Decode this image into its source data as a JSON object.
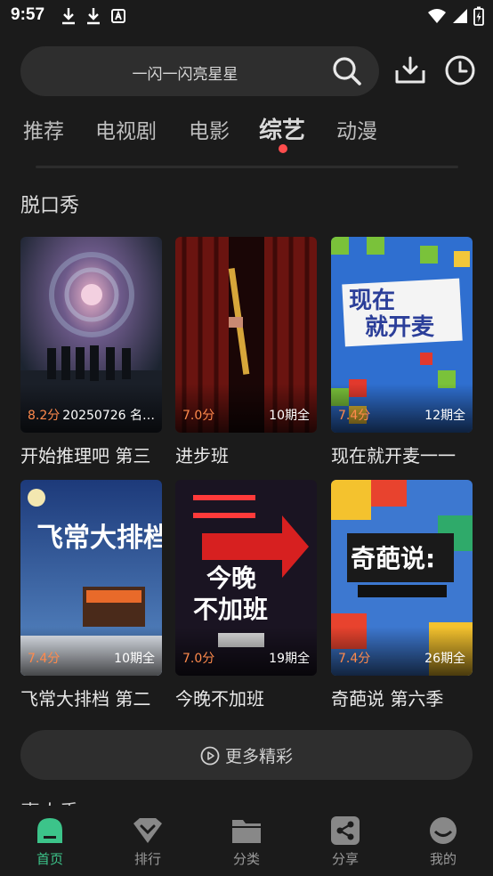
{
  "status_bar": {
    "time": "9:57"
  },
  "search": {
    "placeholder_text": "一闪一闪亮星星"
  },
  "tabs": [
    {
      "label": "推荐"
    },
    {
      "label": "电视剧"
    },
    {
      "label": "电影"
    },
    {
      "label": "综艺",
      "active": true
    },
    {
      "label": "动漫"
    }
  ],
  "section": {
    "title": "脱口秀"
  },
  "cards": [
    {
      "title": "开始推理吧 第三",
      "score": "8.2分",
      "episodes": "20250726 名…"
    },
    {
      "title": "进步班",
      "score": "7.0分",
      "episodes": "10期全"
    },
    {
      "title": "现在就开麦一一",
      "score": "7.4分",
      "episodes": "12期全"
    },
    {
      "title": "飞常大排档 第二",
      "score": "7.4分",
      "episodes": "10期全"
    },
    {
      "title": "今晚不加班",
      "score": "7.0分",
      "episodes": "19期全"
    },
    {
      "title": "奇葩说 第六季",
      "score": "7.4分",
      "episodes": "26期全"
    }
  ],
  "more_button": {
    "label": "更多精彩"
  },
  "next_section_peek": "喜人秀",
  "nav": [
    {
      "label": "首页",
      "icon": "home-icon",
      "active": true
    },
    {
      "label": "排行",
      "icon": "ranking-heart-icon"
    },
    {
      "label": "分类",
      "icon": "folder-icon"
    },
    {
      "label": "分享",
      "icon": "share-icon"
    },
    {
      "label": "我的",
      "icon": "profile-icon"
    }
  ],
  "colors": {
    "accent": "#3cc48a",
    "score": "#ff8a4c",
    "tab_dot": "#ff4d4d",
    "background": "#1b1b1b"
  }
}
